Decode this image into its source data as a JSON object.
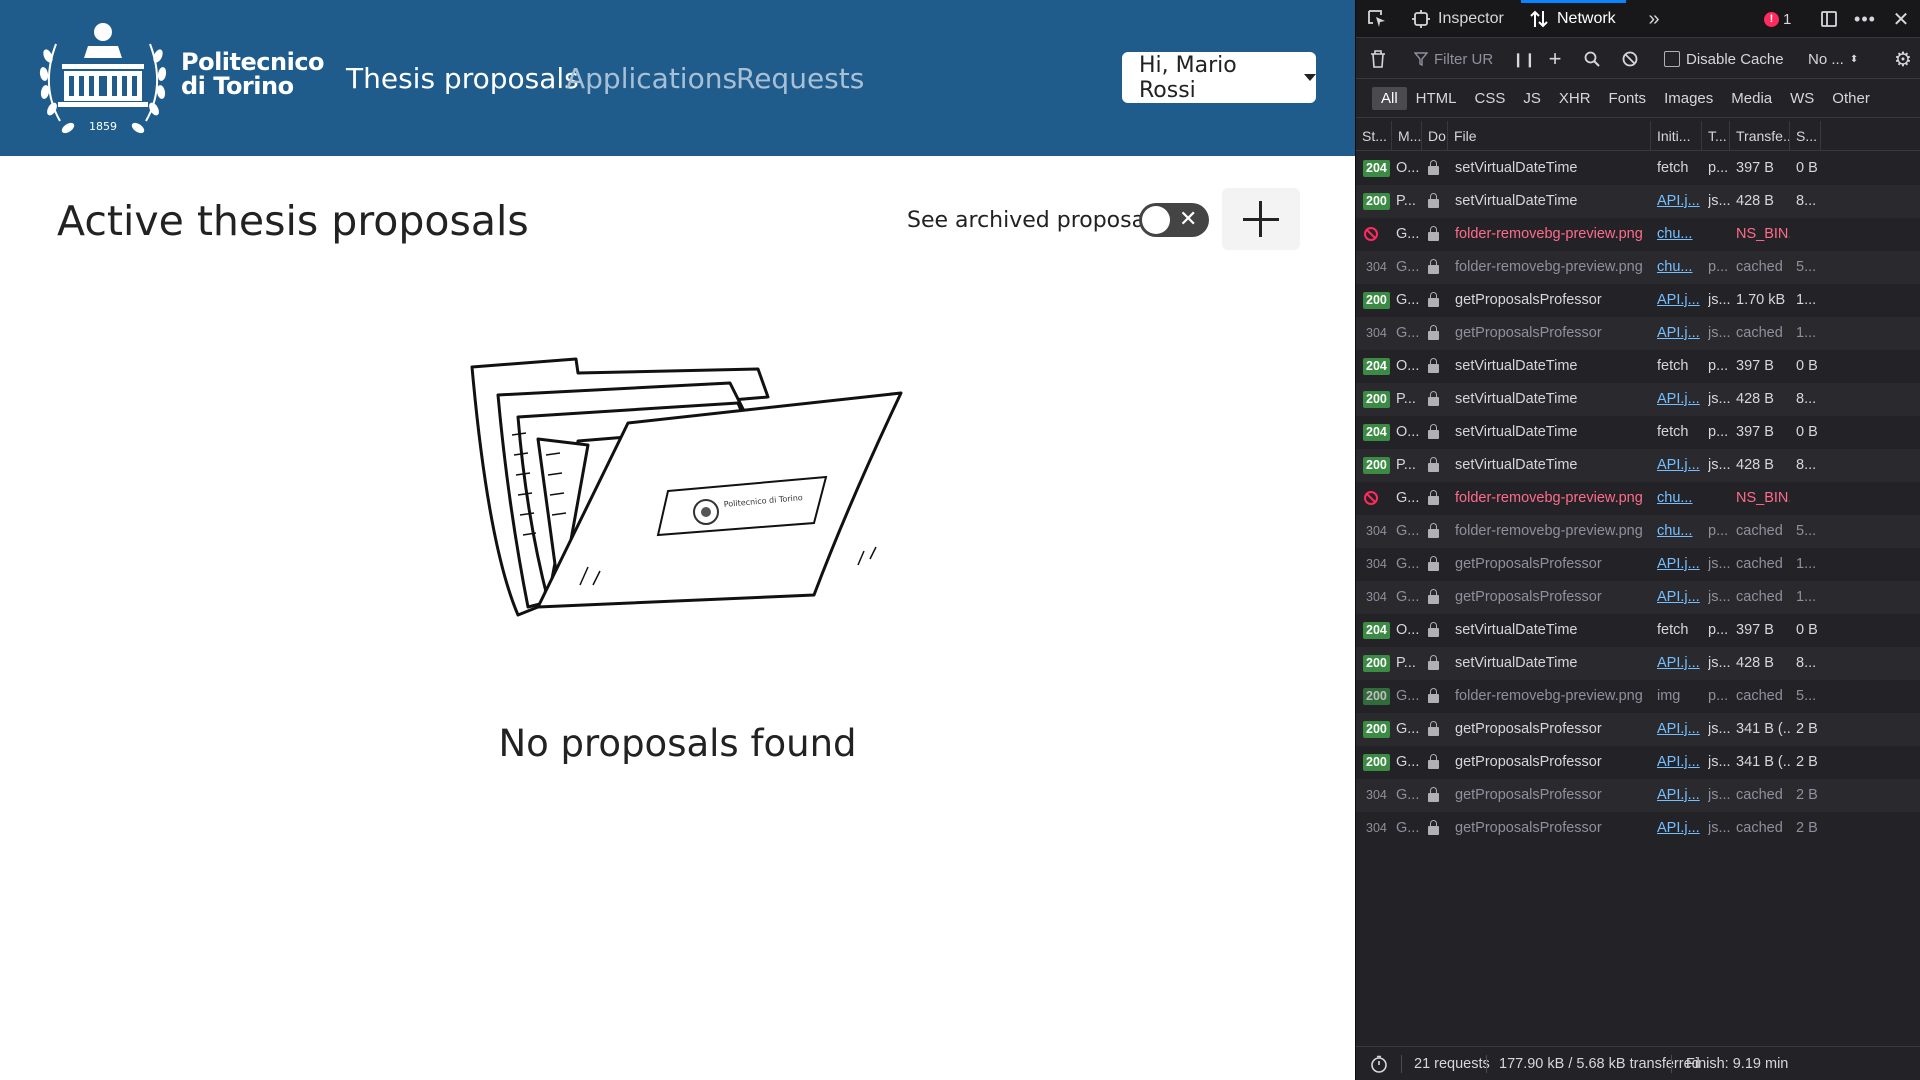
{
  "app": {
    "brand_line1": "Politecnico",
    "brand_line2": "di Torino",
    "logo_year": "1859",
    "nav": [
      "Thesis proposals",
      "Applications",
      "Requests"
    ],
    "user_greeting": "Hi, Mario Rossi",
    "page_title": "Active thesis proposals",
    "archived_label": "See archived proposals",
    "archived_toggle_on": false,
    "empty_text": "No proposals found",
    "folder_logo_text": "Politecnico di Torino",
    "colors": {
      "navbar": "#1f5c8b",
      "nav_inactive": "#a7c0d6"
    }
  },
  "devtools": {
    "tabs": {
      "inspector": "Inspector",
      "network": "Network"
    },
    "error_count": "1",
    "toolbar": {
      "filter_placeholder": "Filter URLs",
      "disable_cache": "Disable Cache",
      "throttle": "No ..."
    },
    "filters": [
      "All",
      "HTML",
      "CSS",
      "JS",
      "XHR",
      "Fonts",
      "Images",
      "Media",
      "WS",
      "Other"
    ],
    "columns": [
      "St...",
      "M...",
      "Do",
      "File",
      "Initi...",
      "T...",
      "Transfe...",
      "S..."
    ],
    "rows": [
      {
        "status": "204",
        "method": "O...",
        "file": "setVirtualDateTime",
        "initiator": "fetch",
        "initiator_link": false,
        "type": "p...",
        "transferred": "397 B",
        "size": "0 B",
        "style": "green"
      },
      {
        "status": "200",
        "method": "P...",
        "file": "setVirtualDateTime",
        "initiator": "API.j...",
        "initiator_link": true,
        "type": "js...",
        "transferred": "428 B",
        "size": "8...",
        "style": "green"
      },
      {
        "status": "blocked",
        "method": "G...",
        "file": "folder-removebg-preview.png",
        "initiator": "chu...",
        "initiator_link": true,
        "type": "",
        "transferred": "NS_BIN...",
        "size": "",
        "style": "blocked"
      },
      {
        "status": "304",
        "method": "G...",
        "file": "folder-removebg-preview.png",
        "initiator": "chu...",
        "initiator_link": true,
        "type": "p...",
        "transferred": "cached",
        "size": "5...",
        "style": "grey"
      },
      {
        "status": "200",
        "method": "G...",
        "file": "getProposalsProfessor",
        "initiator": "API.j...",
        "initiator_link": true,
        "type": "js...",
        "transferred": "1.70 kB",
        "size": "1...",
        "style": "green"
      },
      {
        "status": "304",
        "method": "G...",
        "file": "getProposalsProfessor",
        "initiator": "API.j...",
        "initiator_link": true,
        "type": "js...",
        "transferred": "cached",
        "size": "1...",
        "style": "grey"
      },
      {
        "status": "204",
        "method": "O...",
        "file": "setVirtualDateTime",
        "initiator": "fetch",
        "initiator_link": false,
        "type": "p...",
        "transferred": "397 B",
        "size": "0 B",
        "style": "green"
      },
      {
        "status": "200",
        "method": "P...",
        "file": "setVirtualDateTime",
        "initiator": "API.j...",
        "initiator_link": true,
        "type": "js...",
        "transferred": "428 B",
        "size": "8...",
        "style": "green"
      },
      {
        "status": "204",
        "method": "O...",
        "file": "setVirtualDateTime",
        "initiator": "fetch",
        "initiator_link": false,
        "type": "p...",
        "transferred": "397 B",
        "size": "0 B",
        "style": "green"
      },
      {
        "status": "200",
        "method": "P...",
        "file": "setVirtualDateTime",
        "initiator": "API.j...",
        "initiator_link": true,
        "type": "js...",
        "transferred": "428 B",
        "size": "8...",
        "style": "green"
      },
      {
        "status": "blocked",
        "method": "G...",
        "file": "folder-removebg-preview.png",
        "initiator": "chu...",
        "initiator_link": true,
        "type": "",
        "transferred": "NS_BIN...",
        "size": "",
        "style": "blocked"
      },
      {
        "status": "304",
        "method": "G...",
        "file": "folder-removebg-preview.png",
        "initiator": "chu...",
        "initiator_link": true,
        "type": "p...",
        "transferred": "cached",
        "size": "5...",
        "style": "grey"
      },
      {
        "status": "304",
        "method": "G...",
        "file": "getProposalsProfessor",
        "initiator": "API.j...",
        "initiator_link": true,
        "type": "js...",
        "transferred": "cached",
        "size": "1...",
        "style": "grey"
      },
      {
        "status": "304",
        "method": "G...",
        "file": "getProposalsProfessor",
        "initiator": "API.j...",
        "initiator_link": true,
        "type": "js...",
        "transferred": "cached",
        "size": "1...",
        "style": "grey"
      },
      {
        "status": "204",
        "method": "O...",
        "file": "setVirtualDateTime",
        "initiator": "fetch",
        "initiator_link": false,
        "type": "p...",
        "transferred": "397 B",
        "size": "0 B",
        "style": "green"
      },
      {
        "status": "200",
        "method": "P...",
        "file": "setVirtualDateTime",
        "initiator": "API.j...",
        "initiator_link": true,
        "type": "js...",
        "transferred": "428 B",
        "size": "8...",
        "style": "green"
      },
      {
        "status": "200",
        "method": "G...",
        "file": "folder-removebg-preview.png",
        "initiator": "img",
        "initiator_link": false,
        "type": "p...",
        "transferred": "cached",
        "size": "5...",
        "style": "greygreen"
      },
      {
        "status": "200",
        "method": "G...",
        "file": "getProposalsProfessor",
        "initiator": "API.j...",
        "initiator_link": true,
        "type": "js...",
        "transferred": "341 B (...",
        "size": "2 B",
        "style": "green"
      },
      {
        "status": "200",
        "method": "G...",
        "file": "getProposalsProfessor",
        "initiator": "API.j...",
        "initiator_link": true,
        "type": "js...",
        "transferred": "341 B (...",
        "size": "2 B",
        "style": "green"
      },
      {
        "status": "304",
        "method": "G...",
        "file": "getProposalsProfessor",
        "initiator": "API.j...",
        "initiator_link": true,
        "type": "js...",
        "transferred": "cached",
        "size": "2 B",
        "style": "grey"
      },
      {
        "status": "304",
        "method": "G...",
        "file": "getProposalsProfessor",
        "initiator": "API.j...",
        "initiator_link": true,
        "type": "js...",
        "transferred": "cached",
        "size": "2 B",
        "style": "grey"
      }
    ],
    "status_bar": {
      "requests": "21 requests",
      "transferred": "177.90 kB / 5.68 kB transferred",
      "finish": "Finish: 9.19 min"
    },
    "colors": {
      "bg": "#232327",
      "badge_green": "#3b8b44",
      "blocked": "#ff6b8b",
      "link": "#75bfff",
      "accent": "#0a84ff"
    }
  }
}
